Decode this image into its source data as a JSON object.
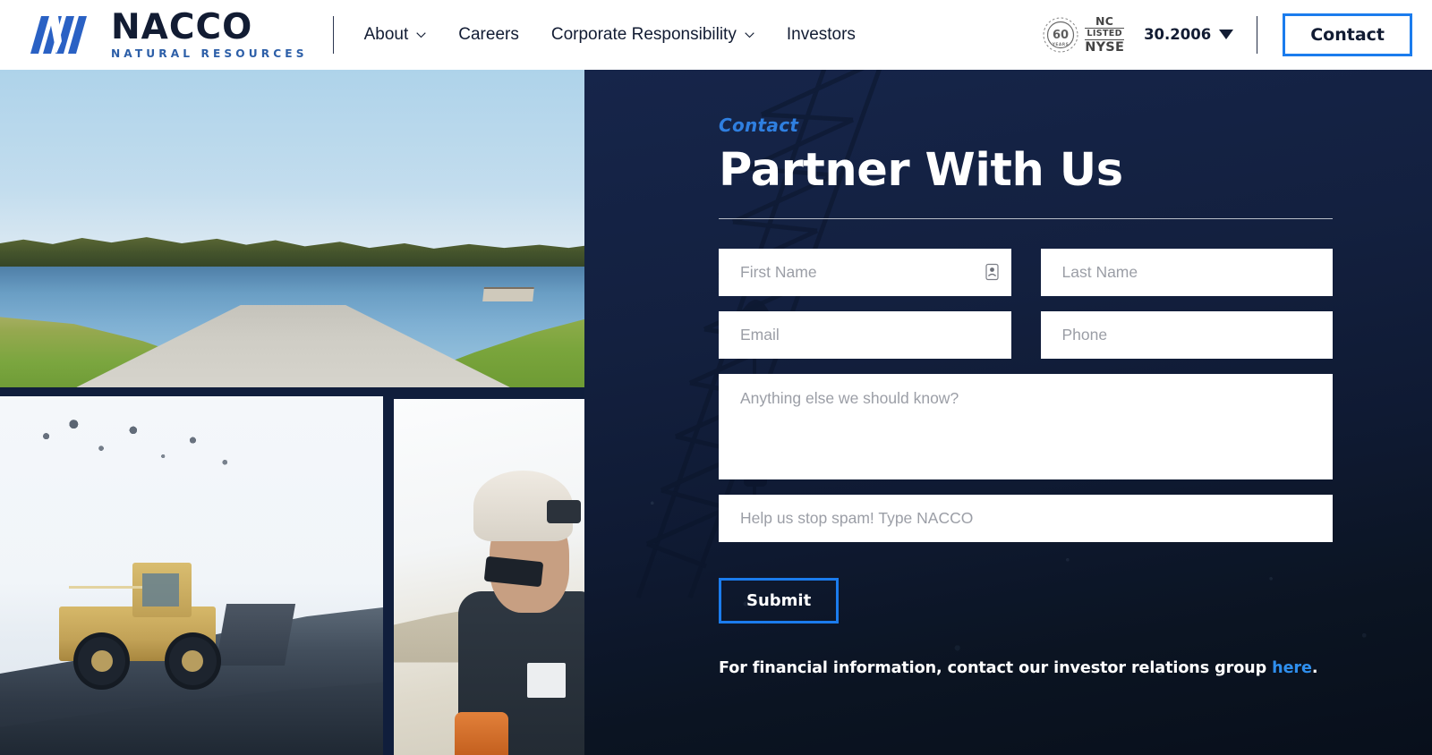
{
  "header": {
    "logo": {
      "mark_icon": "nacco-chevron-logo-icon",
      "wordmark": "NACCO",
      "tagline": "NATURAL RESOURCES"
    },
    "nav": [
      {
        "label": "About",
        "has_dropdown": true
      },
      {
        "label": "Careers",
        "has_dropdown": false
      },
      {
        "label": "Corporate Responsibility",
        "has_dropdown": true
      },
      {
        "label": "Investors",
        "has_dropdown": false
      }
    ],
    "badge": {
      "circle_number": "60",
      "circle_word": "YEARS",
      "line1": "NC",
      "line2": "LISTED",
      "line3": "NYSE"
    },
    "ticker": {
      "value": "30.2006",
      "direction_icon": "triangle-down-icon"
    },
    "contact_button": "Contact"
  },
  "collage": {
    "images": [
      {
        "name": "lake-reclamation-photo",
        "alt": "Lake with gravel boat ramp and autumn treeline"
      },
      {
        "name": "mining-dozer-photo",
        "alt": "Yellow wheel dozer working a snowy mine pit"
      },
      {
        "name": "worker-portrait-photo",
        "alt": "Miner wearing white hard hat and sunglasses"
      }
    ]
  },
  "panel": {
    "eyebrow": "Contact",
    "headline": "Partner With Us",
    "form": {
      "first_name_placeholder": "First Name",
      "last_name_placeholder": "Last Name",
      "email_placeholder": "Email",
      "phone_placeholder": "Phone",
      "message_placeholder": "Anything else we should know?",
      "spam_placeholder": "Help us stop spam! Type NACCO",
      "submit_label": "Submit",
      "autofill_icon": "contact-autofill-icon"
    },
    "fineprint": {
      "text_before": "For financial information, contact our investor relations group ",
      "link_label": "here",
      "text_after": "."
    }
  },
  "colors": {
    "brand_blue": "#1b7ced",
    "logo_blue": "#2d5fa8",
    "navy": "#101e3c",
    "panel_dark": "#0b1422",
    "eyebrow_blue": "#2f7fe0",
    "link_blue": "#2f8fee",
    "white": "#ffffff",
    "placeholder_gray": "#9b9ea6"
  }
}
